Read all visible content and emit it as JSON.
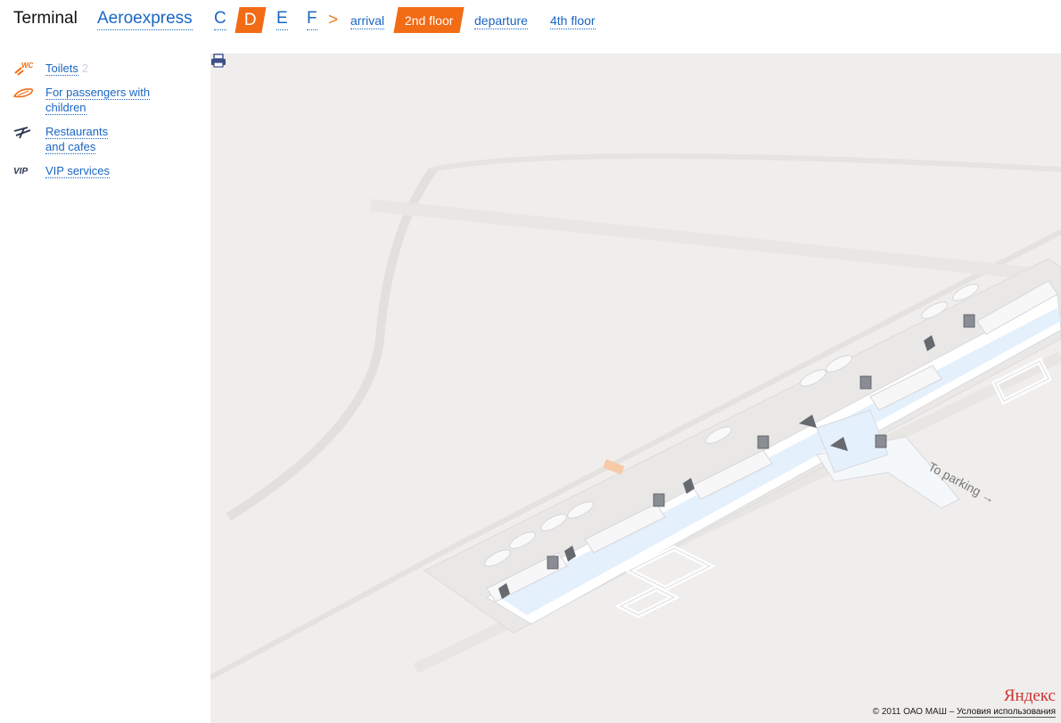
{
  "header": {
    "title": "Terminal",
    "aeroexpress": "Aeroexpress",
    "terminals": [
      "C",
      "D",
      "E",
      "F"
    ],
    "selected_terminal": "D",
    "separator": ">",
    "floors": [
      "arrival",
      "2nd floor",
      "departure",
      "4th floor"
    ],
    "selected_floor": "2nd floor",
    "accent_color": "#f26b15",
    "link_color": "#1a66c2"
  },
  "legend": {
    "items": [
      {
        "label": "Toilets",
        "count": "2",
        "icon": "wc-icon"
      },
      {
        "label": "For passengers with\nchildren",
        "icon": "stroller-icon"
      },
      {
        "label": "Restaurants\nand cafes",
        "icon": "fork-knife-icon"
      },
      {
        "label": "VIP services",
        "icon": "vip-icon"
      }
    ]
  },
  "map": {
    "parking_label": "To parking",
    "brand": "Яндекс",
    "copyright": "© 2011 ОАО МАШ –",
    "terms_link": "Условия использования",
    "print_icon": "print-icon"
  }
}
